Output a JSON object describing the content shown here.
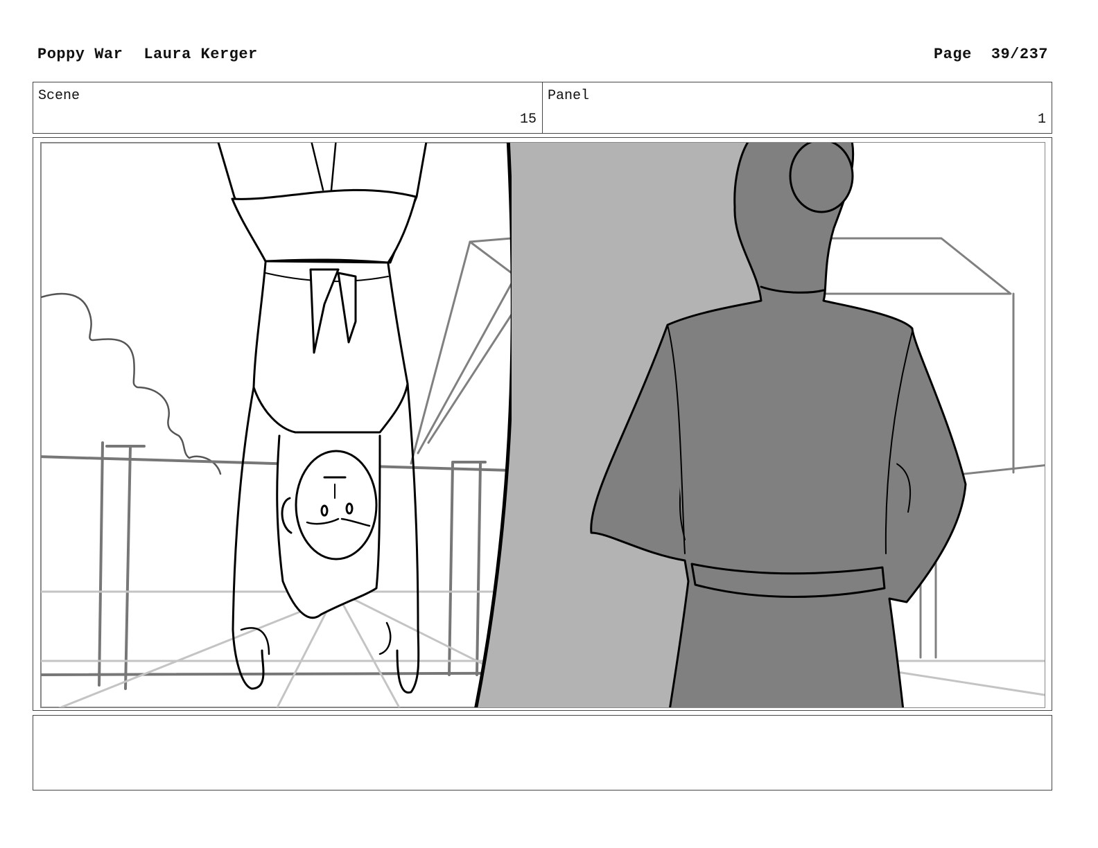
{
  "header": {
    "project": "Poppy War",
    "artist": "Laura Kerger",
    "page_label": "Page",
    "page_number": "39/237"
  },
  "scene": {
    "label": "Scene",
    "value": "15"
  },
  "panel": {
    "label": "Panel",
    "value": "1"
  },
  "notes": {
    "text": ""
  }
}
